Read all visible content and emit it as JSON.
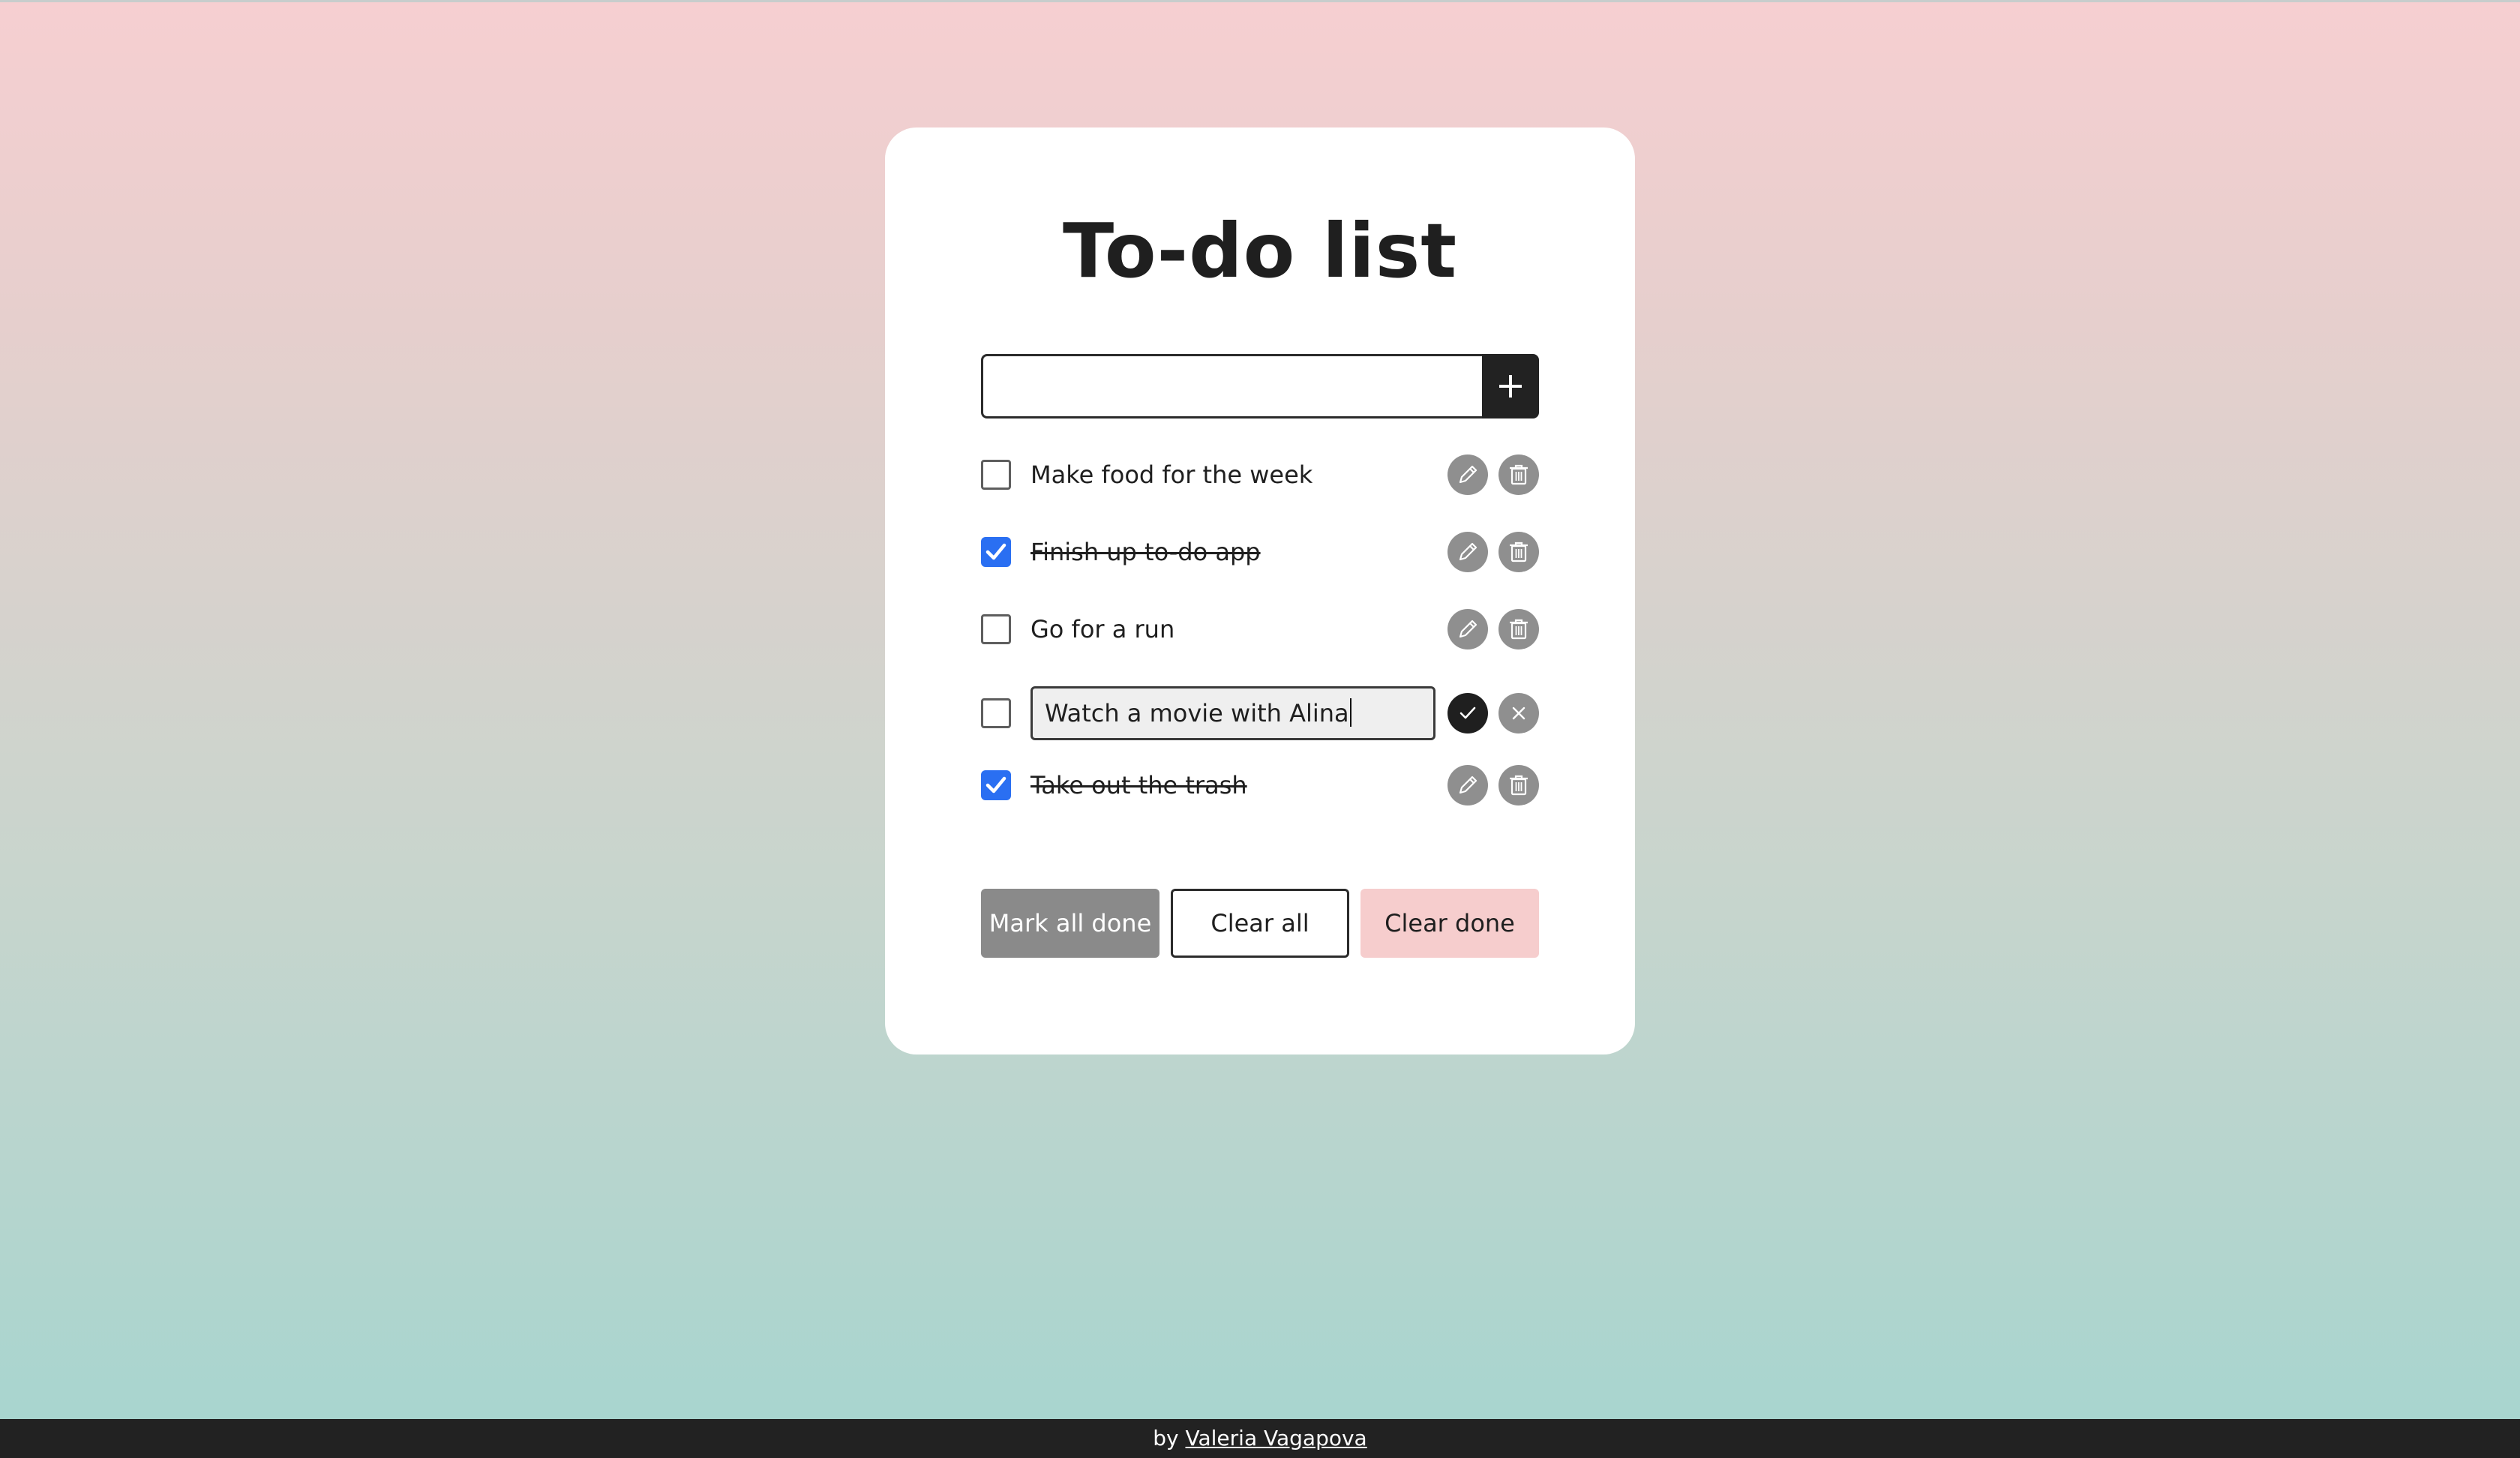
{
  "page": {
    "title": "To-do list"
  },
  "new_todo": {
    "value": "",
    "placeholder": "",
    "add_button_icon": "plus-icon"
  },
  "todos": [
    {
      "label": "Make food for the week",
      "checked": false,
      "editing": false
    },
    {
      "label": "Finish up to-do app",
      "checked": true,
      "editing": false
    },
    {
      "label": "Go for a run",
      "checked": false,
      "editing": false
    },
    {
      "label": "Watch a movie with Alina",
      "checked": false,
      "editing": true
    },
    {
      "label": "Take out the trash",
      "checked": true,
      "editing": false
    }
  ],
  "icons": {
    "edit": "pencil-icon",
    "delete": "trash-icon",
    "confirm": "check-icon",
    "cancel": "close-icon"
  },
  "actions": {
    "mark_all_done": "Mark all done",
    "clear_all": "Clear all",
    "clear_done": "Clear done"
  },
  "footer": {
    "prefix": "by",
    "author": "Valeria Vagapova"
  },
  "colors": {
    "checkbox_checked": "#2a6ff2",
    "icon_button": "#8f8f8f",
    "add_button": "#222222",
    "clear_done_bg": "#f6cdcd",
    "mark_all_bg": "#8a8a8a",
    "gradient_top": "#f6cfd1",
    "gradient_bottom": "#a6d5cf"
  }
}
